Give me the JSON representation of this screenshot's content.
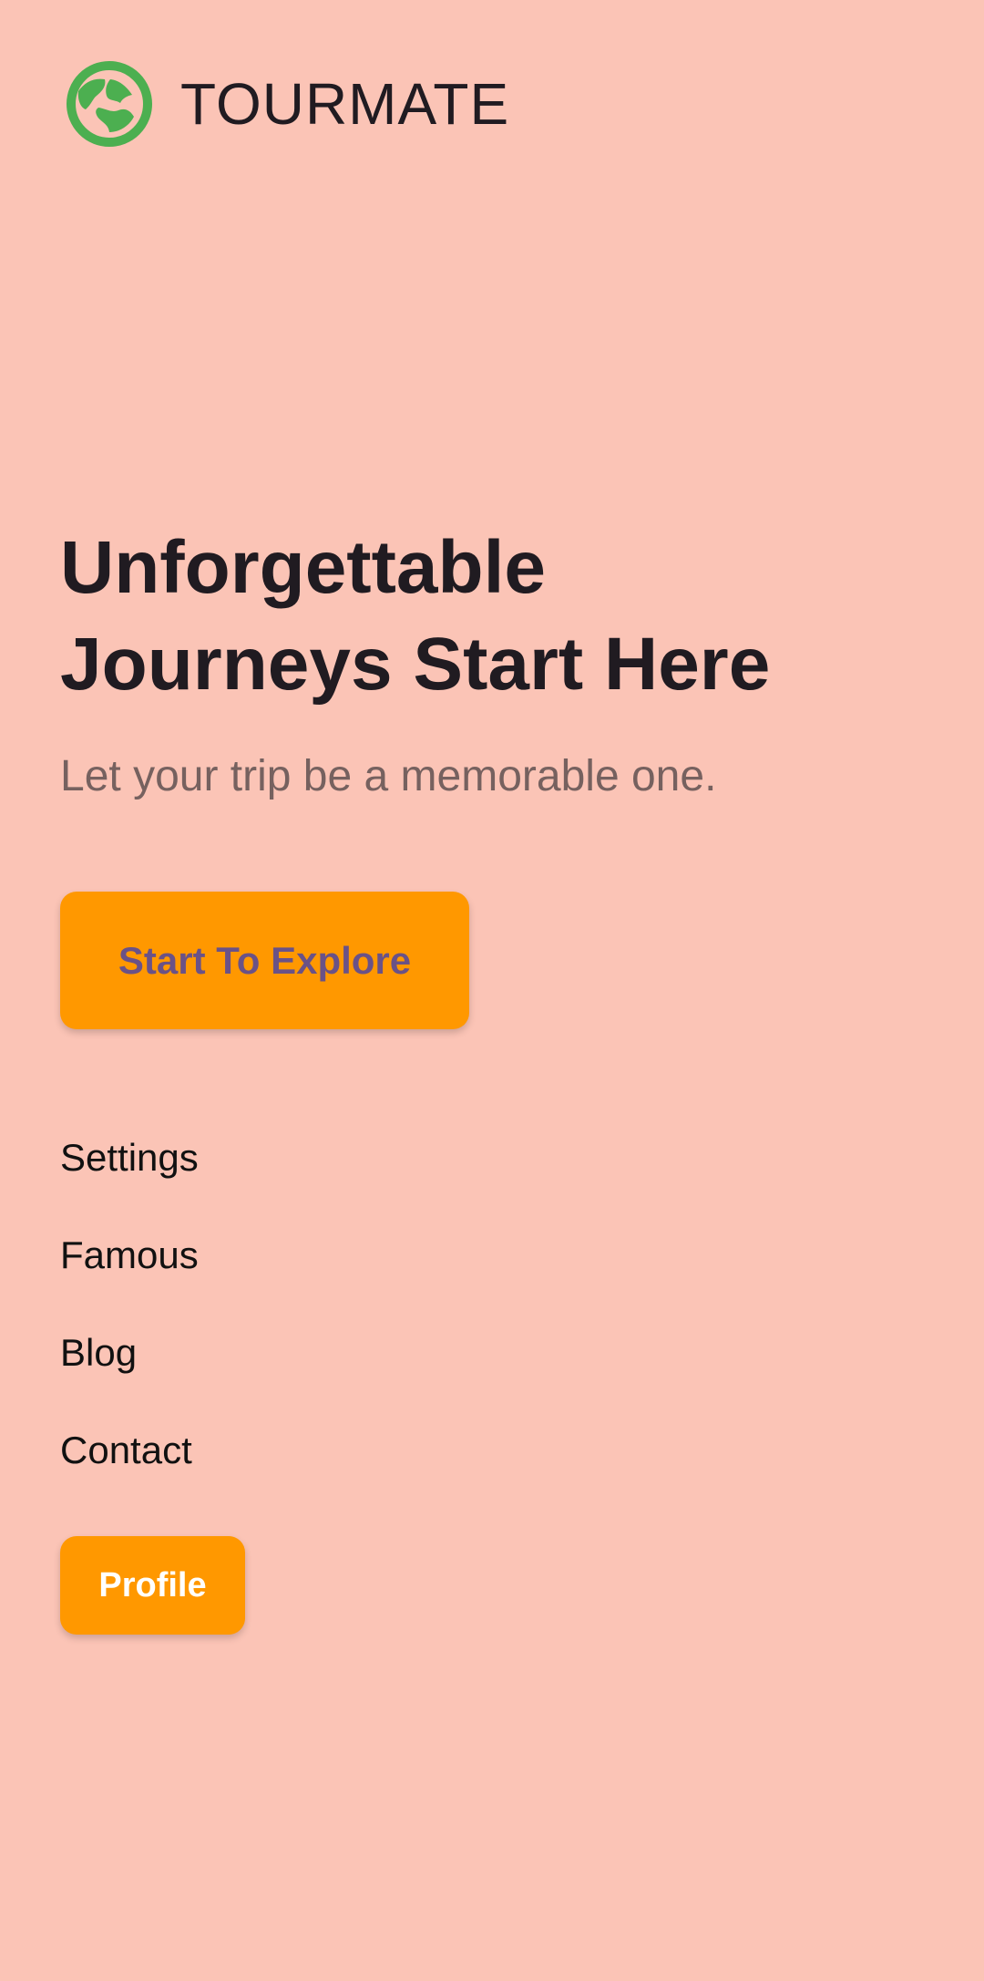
{
  "app": {
    "brand": "TOURMATE",
    "logo_icon": "globe-icon",
    "colors": {
      "background": "#FBC4B6",
      "accent": "#FF9800",
      "logo": "#4CAF50",
      "explore_text": "#6A5287"
    }
  },
  "hero": {
    "title_line_1": "Unforgettable",
    "title_line_2": "Journeys Start Here",
    "subtitle": "Let your trip be a memorable one.",
    "cta_label": "Start To Explore"
  },
  "menu": {
    "items": [
      {
        "label": "Settings"
      },
      {
        "label": "Famous"
      },
      {
        "label": "Blog"
      },
      {
        "label": "Contact"
      }
    ],
    "profile_label": "Profile"
  }
}
